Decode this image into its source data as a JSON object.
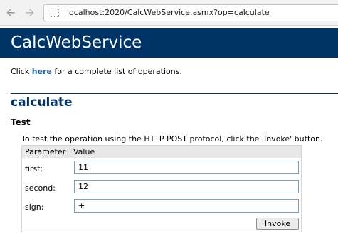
{
  "browser": {
    "back_icon": "back-arrow-icon",
    "forward_icon": "forward-arrow-icon",
    "page_icon": "page-icon",
    "url": "localhost:2020/CalcWebService.asmx?op=calculate"
  },
  "banner": {
    "title": "CalcWebService",
    "background_color": "#003366"
  },
  "intro": {
    "prefix": "Click ",
    "link_text": "here",
    "suffix": " for a complete list of operations."
  },
  "operation": {
    "title": "calculate",
    "test_heading": "Test",
    "test_description": "To test the operation using the HTTP POST protocol, click the 'Invoke' button."
  },
  "form": {
    "header_parameter": "Parameter",
    "header_value": "Value",
    "fields": [
      {
        "label": "first:",
        "value": "11"
      },
      {
        "label": "second:",
        "value": "12"
      },
      {
        "label": "sign:",
        "value": "+"
      }
    ],
    "invoke_label": "Invoke"
  }
}
